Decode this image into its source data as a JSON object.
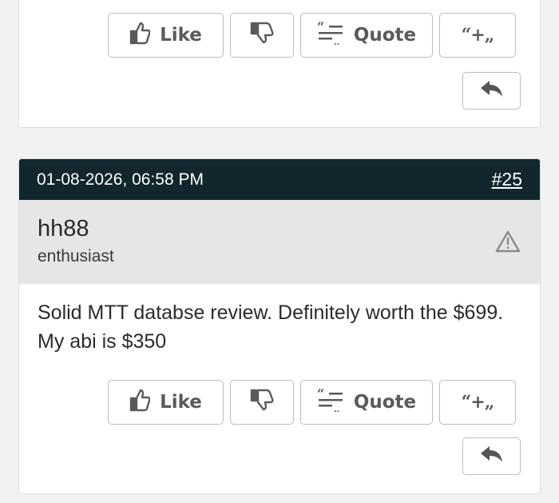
{
  "buttons": {
    "like_label": "Like",
    "quote_label": "Quote",
    "multiquote_label": "“+„"
  },
  "post": {
    "date": "01-08-2026, 06:58 PM",
    "number": "#25",
    "username": "hh88",
    "user_title": "enthusiast",
    "body": "Solid MTT databse review. Definitely worth the $699. My abi is $350"
  },
  "colors": {
    "header_bg": "#12262e",
    "userbar_bg": "#e6e6e6",
    "button_border": "#bdbdbd",
    "button_text": "#5a5a5a"
  },
  "icons": [
    "thumbs-up-icon",
    "thumbs-down-icon",
    "quote-icon",
    "multiquote-icon",
    "reply-icon",
    "warning-icon"
  ]
}
